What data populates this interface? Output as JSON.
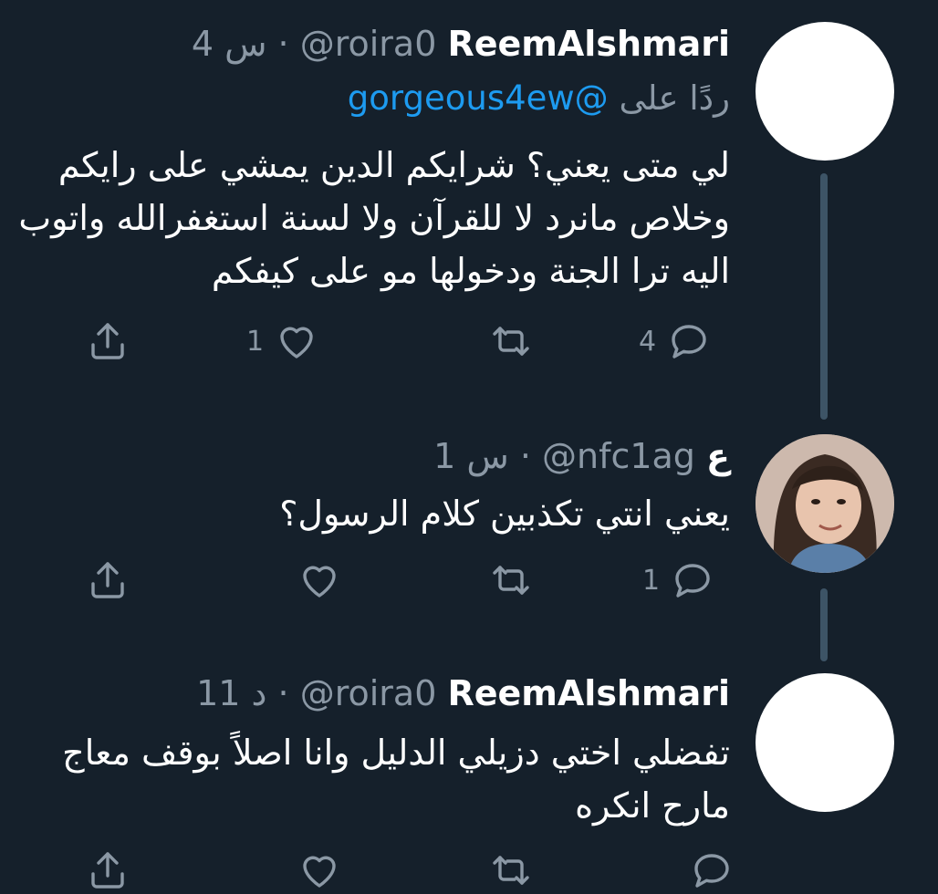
{
  "tweets": [
    {
      "display_name": "ReemAlshmari",
      "meta": "4 س · @roira0",
      "replying_prefix": "ردًا على",
      "replying_handle": "@gorgeous4ew",
      "lines": [
        "لي متى يعني؟ شرايكم الدين يمشي على رايكم",
        "وخلاص مانرد لا للقرآن ولا لسنة استغفرالله واتوب",
        "اليه ترا الجنة ودخولها مو على كيفكم"
      ],
      "reply_count": "4",
      "retweet_count": "",
      "like_count": "1"
    },
    {
      "display_name": "ع",
      "meta": "1 س · @nfc1ag",
      "lines": [
        "يعني انتي تكذبين كلام الرسول؟"
      ],
      "reply_count": "1",
      "retweet_count": "",
      "like_count": ""
    },
    {
      "display_name": "ReemAlshmari",
      "meta": "11 د · @roira0",
      "lines": [
        "تفضلي اختي دزيلي الدليل وانا اصلاً بوقف معاج",
        "مارح انكره"
      ],
      "reply_count": "",
      "retweet_count": "",
      "like_count": ""
    }
  ],
  "icons": {
    "reply": "reply-icon",
    "retweet": "retweet-icon",
    "like": "heart-icon",
    "share": "share-icon"
  },
  "colors": {
    "background": "#15202b",
    "text": "#ffffff",
    "muted": "#8b98a5",
    "accent": "#1d9bf0",
    "thread_line": "#3d5466"
  }
}
